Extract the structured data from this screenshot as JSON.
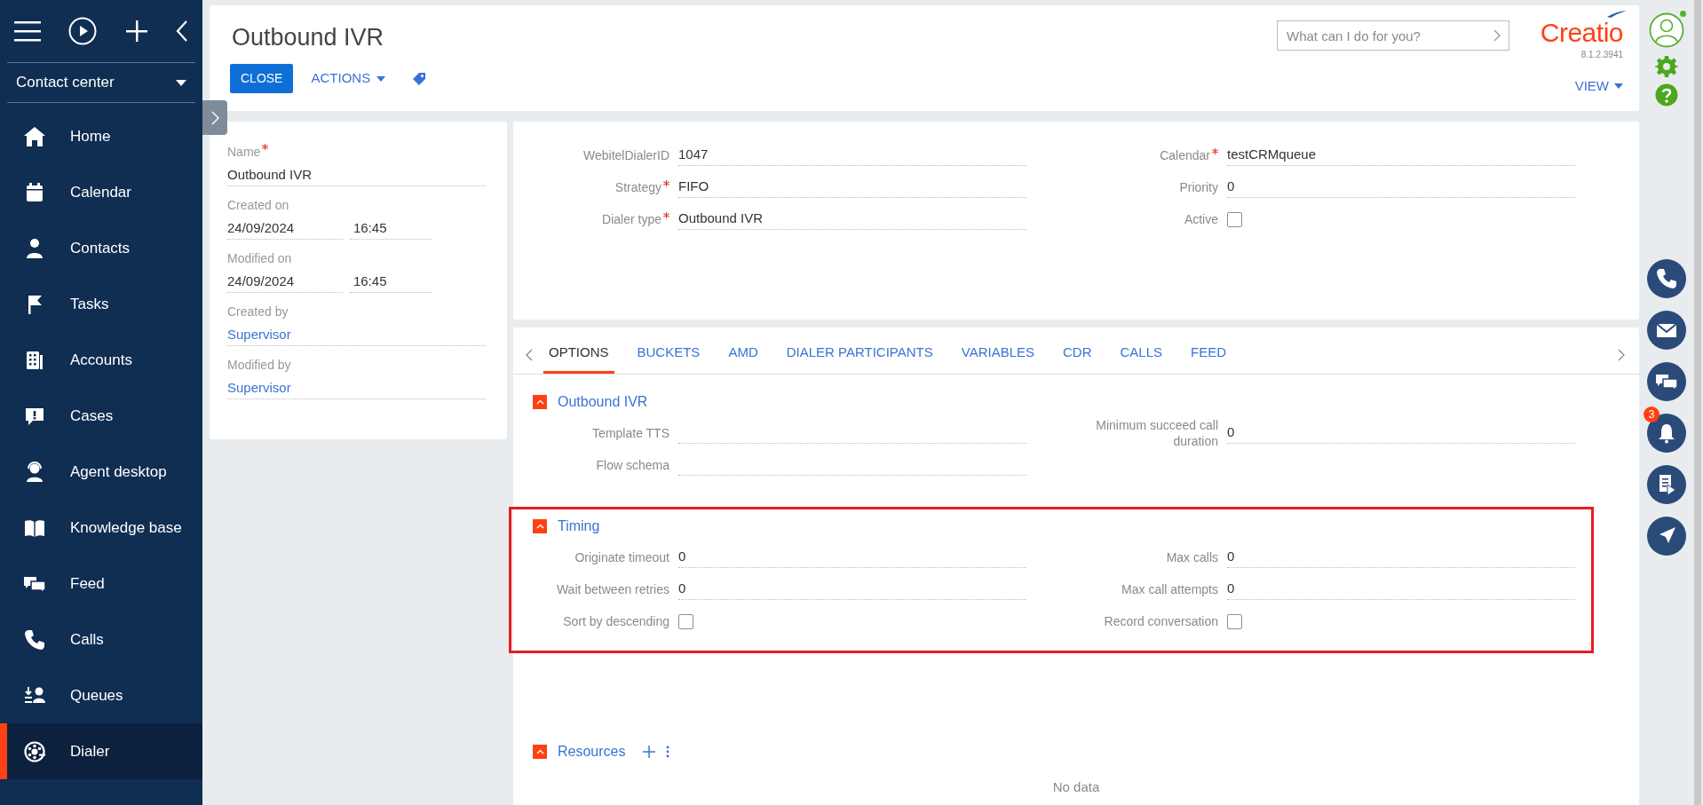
{
  "sidebar": {
    "workspace": "Contact center",
    "items": [
      {
        "label": "Home",
        "selected": false
      },
      {
        "label": "Calendar",
        "selected": false
      },
      {
        "label": "Contacts",
        "selected": false
      },
      {
        "label": "Tasks",
        "selected": false
      },
      {
        "label": "Accounts",
        "selected": false
      },
      {
        "label": "Cases",
        "selected": false
      },
      {
        "label": "Agent desktop",
        "selected": false
      },
      {
        "label": "Knowledge base",
        "selected": false
      },
      {
        "label": "Feed",
        "selected": false
      },
      {
        "label": "Calls",
        "selected": false
      },
      {
        "label": "Queues",
        "selected": false
      },
      {
        "label": "Dialer",
        "selected": true
      }
    ]
  },
  "header": {
    "title": "Outbound IVR",
    "close_button": "CLOSE",
    "actions_button": "ACTIONS",
    "view_button": "VIEW",
    "search": {
      "placeholder": "What can I do for you?"
    },
    "logo": "Creatio",
    "version": "8.1.2.3941"
  },
  "summary": [
    {
      "label": "Name",
      "required": true,
      "kind": "text",
      "value": "Outbound IVR"
    },
    {
      "label": "Created on",
      "required": false,
      "kind": "datetime",
      "value": "24/09/2024",
      "time": "16:45"
    },
    {
      "label": "Modified on",
      "required": false,
      "kind": "datetime",
      "value": "24/09/2024",
      "time": "16:45"
    },
    {
      "label": "Created by",
      "required": false,
      "kind": "link",
      "value": "Supervisor"
    },
    {
      "label": "Modified by",
      "required": false,
      "kind": "link",
      "value": "Supervisor"
    }
  ],
  "details": {
    "left": [
      {
        "label": "WebitelDialerID",
        "required": false,
        "kind": "text",
        "value": "1047"
      },
      {
        "label": "Strategy",
        "required": true,
        "kind": "text",
        "value": "FIFO"
      },
      {
        "label": "Dialer type",
        "required": true,
        "kind": "text",
        "value": "Outbound IVR"
      }
    ],
    "right": [
      {
        "label": "Calendar",
        "required": true,
        "kind": "text",
        "value": "testCRMqueue"
      },
      {
        "label": "Priority",
        "required": false,
        "kind": "text",
        "value": "0"
      },
      {
        "label": "Active",
        "required": false,
        "kind": "checkbox",
        "checked": false
      }
    ]
  },
  "tabs": [
    {
      "label": "OPTIONS",
      "selected": true
    },
    {
      "label": "BUCKETS",
      "selected": false
    },
    {
      "label": "AMD",
      "selected": false
    },
    {
      "label": "DIALER PARTICIPANTS",
      "selected": false
    },
    {
      "label": "VARIABLES",
      "selected": false
    },
    {
      "label": "CDR",
      "selected": false
    },
    {
      "label": "CALLS",
      "selected": false
    },
    {
      "label": "FEED",
      "selected": false
    }
  ],
  "sections": [
    {
      "title": "Outbound IVR",
      "kind": "fields",
      "expanded": true,
      "highlighted": false,
      "left": [
        {
          "label": "Template TTS",
          "required": false,
          "kind": "text"
        },
        {
          "label": "Flow schema",
          "required": false,
          "kind": "text"
        }
      ],
      "right": [
        {
          "label": "Minimum succeed call duration",
          "required": false,
          "kind": "text",
          "value": "0"
        }
      ]
    },
    {
      "title": "Timing",
      "kind": "fields",
      "expanded": true,
      "highlighted": true,
      "left": [
        {
          "label": "Originate timeout",
          "required": false,
          "kind": "text",
          "value": "0"
        },
        {
          "label": "Wait between retries",
          "required": false,
          "kind": "text",
          "value": "0"
        },
        {
          "label": "Sort by descending",
          "required": false,
          "kind": "checkbox",
          "checked": false
        }
      ],
      "right": [
        {
          "label": "Max calls",
          "required": false,
          "kind": "text",
          "value": "0"
        },
        {
          "label": "Max call attempts",
          "required": false,
          "kind": "text",
          "value": "0"
        },
        {
          "label": "Record conversation",
          "required": false,
          "kind": "checkbox",
          "checked": false
        }
      ]
    },
    {
      "title": "Resources",
      "kind": "detail",
      "expanded": true,
      "highlighted": false,
      "empty_text": "No data"
    }
  ],
  "notifications": {
    "count": "3"
  }
}
